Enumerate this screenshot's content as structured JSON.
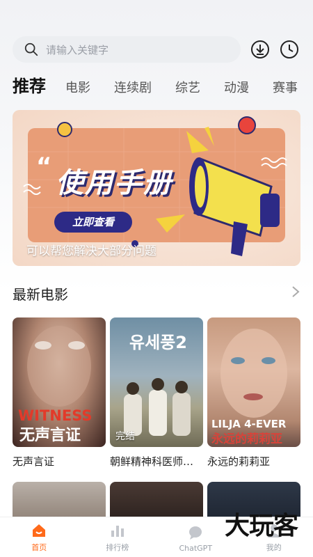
{
  "search": {
    "placeholder": "请输入关键字"
  },
  "tabs": [
    "推荐",
    "电影",
    "连续剧",
    "综艺",
    "动漫",
    "赛事"
  ],
  "banner": {
    "title": "使用手册",
    "button_label": "立即查看",
    "caption": "可以帮您解决大部分问题"
  },
  "section": {
    "title": "最新电影"
  },
  "movies": [
    {
      "title": "无声言证",
      "poster_text": "WITNESS",
      "poster_sub": "无声言证",
      "badge": ""
    },
    {
      "title": "朝鲜精神科医师…",
      "poster_text": "유세풍2",
      "poster_sub": "",
      "badge": "完结"
    },
    {
      "title": "永远的莉莉亚",
      "poster_text": "LILJA 4-EVER",
      "poster_sub": "永远的莉莉亚",
      "badge": ""
    }
  ],
  "nav": [
    {
      "label": "首页",
      "icon": "home-icon",
      "active": true
    },
    {
      "label": "排行榜",
      "icon": "chart-icon",
      "active": false
    },
    {
      "label": "ChatGPT",
      "icon": "chat-icon",
      "active": false
    },
    {
      "label": "我的",
      "icon": "user-icon",
      "active": false
    }
  ],
  "watermark": "大玩客",
  "colors": {
    "accent": "#ff6a1a",
    "banner_btn": "#2d2a86"
  }
}
